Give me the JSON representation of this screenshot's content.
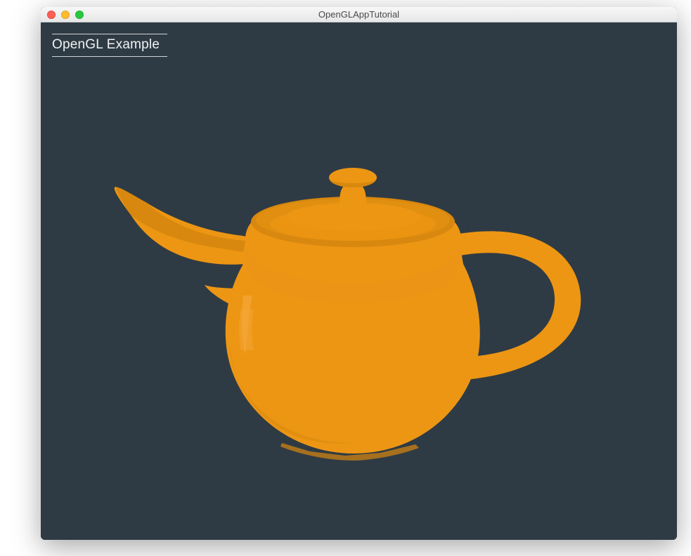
{
  "window": {
    "title": "OpenGLAppTutorial"
  },
  "panel": {
    "title": "OpenGL Example"
  },
  "traffic_lights": {
    "close": "close",
    "minimize": "minimize",
    "maximize": "maximize"
  },
  "render": {
    "object": "teapot",
    "colors": {
      "background": "#2f3b44",
      "base": "#ed9614",
      "shade_dark": "#d8880e",
      "shade_mid": "#e7921a",
      "highlight": "#f4a637"
    }
  }
}
